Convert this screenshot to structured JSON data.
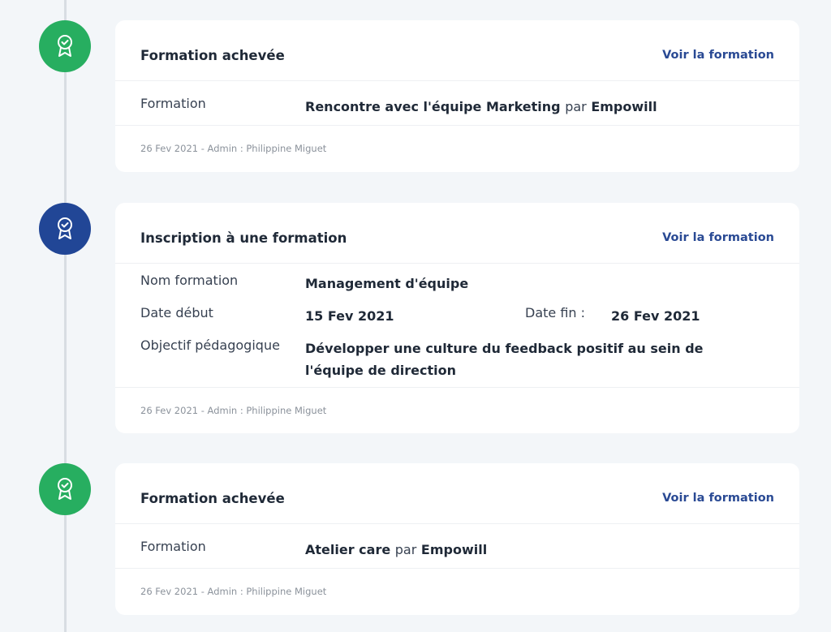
{
  "colors": {
    "green": "#27ae60",
    "blue": "#214696",
    "link": "#2a4a94",
    "background": "#f3f6f9"
  },
  "items": [
    {
      "icon": "award-ribbon-icon",
      "title": "Formation achevée",
      "link": "Voir la formation",
      "field_label": "Formation",
      "course": "Rencontre avec l'équipe Marketing",
      "by": "par",
      "provider": "Empowill",
      "footer": "26 Fev 2021 - Admin : Philippine Miguet"
    },
    {
      "icon": "award-ribbon-icon",
      "title": "Inscription à une formation",
      "link": "Voir la formation",
      "name_label": "Nom formation",
      "name": "Management d'équipe",
      "start_label": "Date début",
      "start": "15 Fev 2021",
      "end_label": "Date fin :",
      "end": "26 Fev 2021",
      "objective_label": "Objectif pédagogique",
      "objective": "Développer une culture du feedback positif au sein de l'équipe de direction",
      "footer": "26 Fev 2021 - Admin : Philippine Miguet"
    },
    {
      "icon": "award-ribbon-icon",
      "title": "Formation achevée",
      "link": "Voir la formation",
      "field_label": "Formation",
      "course": "Atelier care",
      "by": "par",
      "provider": "Empowill",
      "footer": "26 Fev 2021 - Admin : Philippine Miguet"
    }
  ]
}
